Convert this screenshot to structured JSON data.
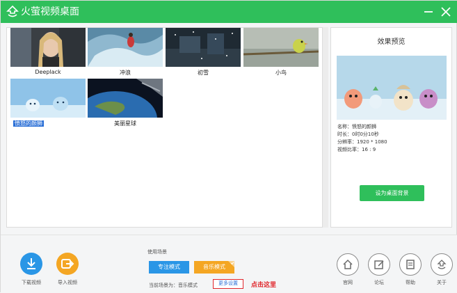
{
  "app": {
    "title": "火萤视频桌面"
  },
  "gallery": {
    "items": [
      {
        "label": "Deeplack"
      },
      {
        "label": "冲浪"
      },
      {
        "label": "初雪"
      },
      {
        "label": "小鸟"
      },
      {
        "label": "愤怒的颜狮",
        "selected": true
      },
      {
        "label": "美丽星球"
      }
    ]
  },
  "preview": {
    "title": "效果预览",
    "name": "名称：愤怒的颜狮",
    "duration": "时长：0时0分10秒",
    "resolution": "分辨率：1920 * 1080",
    "aspect_ratio": "视频比率：16 : 9",
    "set_bg_label": "设为桌面背景"
  },
  "bottom": {
    "download_label": "下载视频",
    "import_label": "导入视频",
    "scene_label": "使用场景",
    "focus_mode": "专注模式",
    "music_mode": "音乐模式",
    "current_scene": "当前场景为：音乐模式",
    "more_settings": "更多设置",
    "click_here": "点击这里",
    "official_label": "官网",
    "forum_label": "论坛",
    "help_label": "帮助",
    "about_label": "关于"
  },
  "colors": {
    "brand_green": "#2fbf5b",
    "accent_blue": "#2a96e6",
    "accent_orange": "#f4a623",
    "highlight_red": "#e0262b"
  }
}
